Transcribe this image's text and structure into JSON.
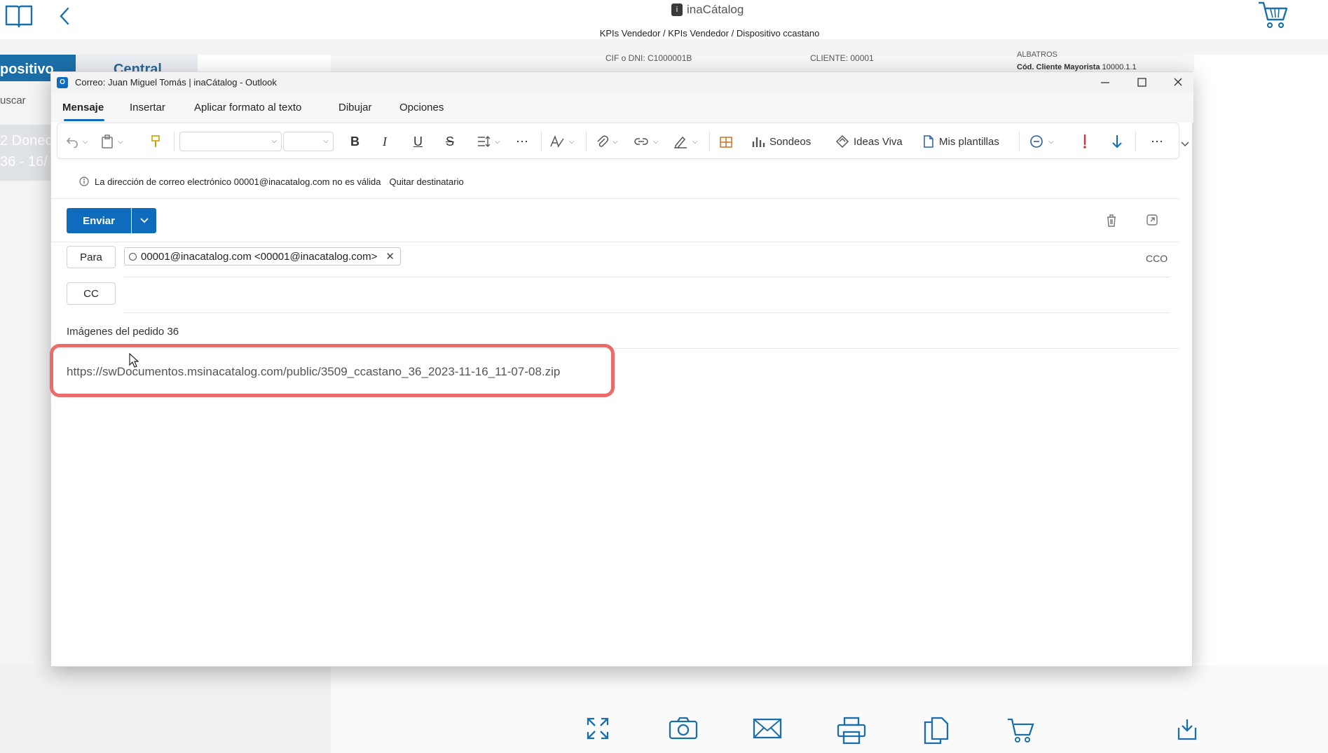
{
  "app": {
    "brand": "inaCátalog",
    "breadcrumb": "KPIs Vendedor / KPIs Vendedor / Dispositivo ccastano",
    "left_tab_active": "positivo",
    "left_tab_other": "Central",
    "search_partial": "uscar",
    "list_text_1": "2 Donec",
    "list_text_2": "36 - 16/",
    "header_cif": "CIF o DNI: C1000001B",
    "header_cliente": "CLIENTE: 00001",
    "header_albatros": "ALBATROS",
    "header_cod": "Cód. Cliente Mayorista",
    "header_cod_value": "10000.1.1"
  },
  "window": {
    "title": "Correo: Juan Miguel Tomás | inaCátalog - Outlook",
    "tabs": [
      "Mensaje",
      "Insertar",
      "Aplicar formato al texto",
      "Dibujar",
      "Opciones"
    ],
    "active_tab": "Mensaje"
  },
  "toolbar": {
    "polls_label": "Sondeos",
    "viva_label": "Ideas Viva",
    "templates_label": "Mis plantillas"
  },
  "info_bar": {
    "message": "La dirección de correo electrónico 00001@inacatalog.com no es válida",
    "action": "Quitar destinatario"
  },
  "compose": {
    "send_label": "Enviar",
    "to_label": "Para",
    "cc_label": "CC",
    "bcc_label": "CCO",
    "recipient": "00001@inacatalog.com <00001@inacatalog.com>",
    "subject": "Imágenes del pedido 36",
    "body": "https://swDocumentos.msinacatalog.com/public/3509_ccastano_36_2023-11-16_11-07-08.zip"
  },
  "colors": {
    "accent": "#0f6cbd",
    "highlight": "#ec6a68",
    "app_blue": "#1b6fa8"
  }
}
